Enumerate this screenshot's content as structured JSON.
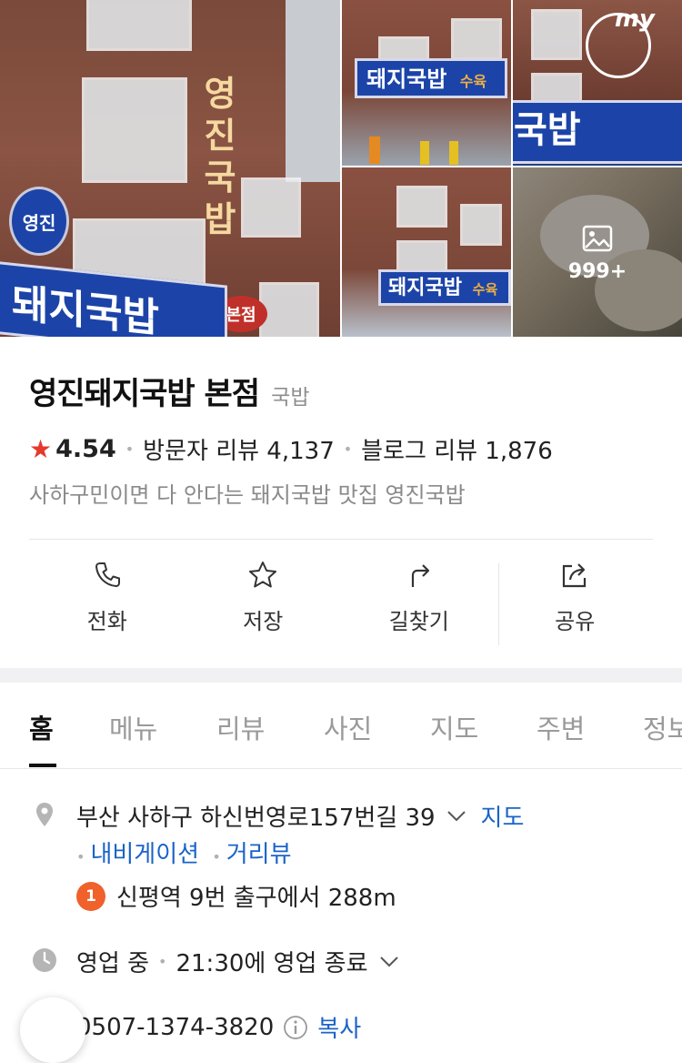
{
  "photos": {
    "main_sign_vertical": "영진국밥",
    "main_round_sign": "영진",
    "main_branch_sign": "본점",
    "shop_sign": "돼지국밥",
    "shop_sign_small": "수육",
    "more_count": "999+",
    "my_badge": "my"
  },
  "place": {
    "name": "영진돼지국밥 본점",
    "category": "국밥",
    "rating": "4.54",
    "visitor_reviews": "방문자 리뷰 4,137",
    "blog_reviews": "블로그 리뷰 1,876",
    "description": "사하구민이면 다 안다는 돼지국밥 맛집 영진국밥"
  },
  "actions": [
    {
      "label": "전화",
      "icon": "phone-icon"
    },
    {
      "label": "저장",
      "icon": "star-icon"
    },
    {
      "label": "길찾기",
      "icon": "directions-icon"
    },
    {
      "label": "공유",
      "icon": "share-icon"
    }
  ],
  "tabs": [
    "홈",
    "메뉴",
    "리뷰",
    "사진",
    "지도",
    "주변",
    "정보"
  ],
  "active_tab": "홈",
  "details": {
    "address": "부산 사하구 하신번영로157번길 39",
    "map_link": "지도",
    "navigation_link": "내비게이션",
    "streetview_link": "거리뷰",
    "subway_line": "1",
    "subway_text": "신평역 9번 출구에서 288m",
    "hours_status": "영업 중",
    "hours_text": "21:30에 영업 종료",
    "phone": "0507-1374-3820",
    "copy_label": "복사"
  },
  "colors": {
    "accent": "#1a63c8",
    "star": "#e5392c",
    "subway_line1": "#f0612b",
    "sign_blue": "#1c44a8"
  }
}
